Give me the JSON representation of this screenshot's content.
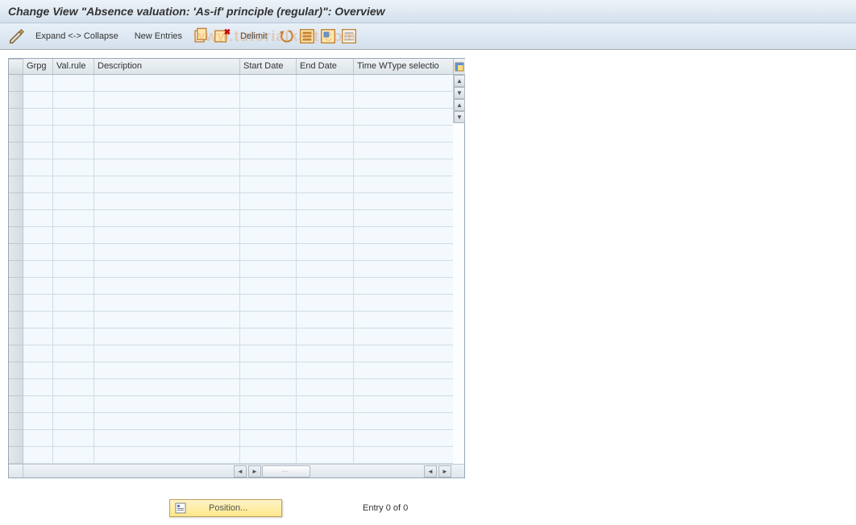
{
  "header": {
    "title": "Change View \"Absence valuation: 'As-if' principle (regular)\": Overview"
  },
  "toolbar": {
    "expand_collapse": "Expand <-> Collapse",
    "new_entries": "New Entries",
    "delimit": "Delimit"
  },
  "grid": {
    "columns": {
      "grpg": "Grpg",
      "val_rule": "Val.rule",
      "description": "Description",
      "start_date": "Start Date",
      "end_date": "End Date",
      "time_wtype": "Time WType selectio"
    },
    "row_count": 23
  },
  "footer": {
    "position_label": "Position...",
    "entry_text": "Entry 0 of 0"
  },
  "watermark": "www.tutorialkart.com"
}
